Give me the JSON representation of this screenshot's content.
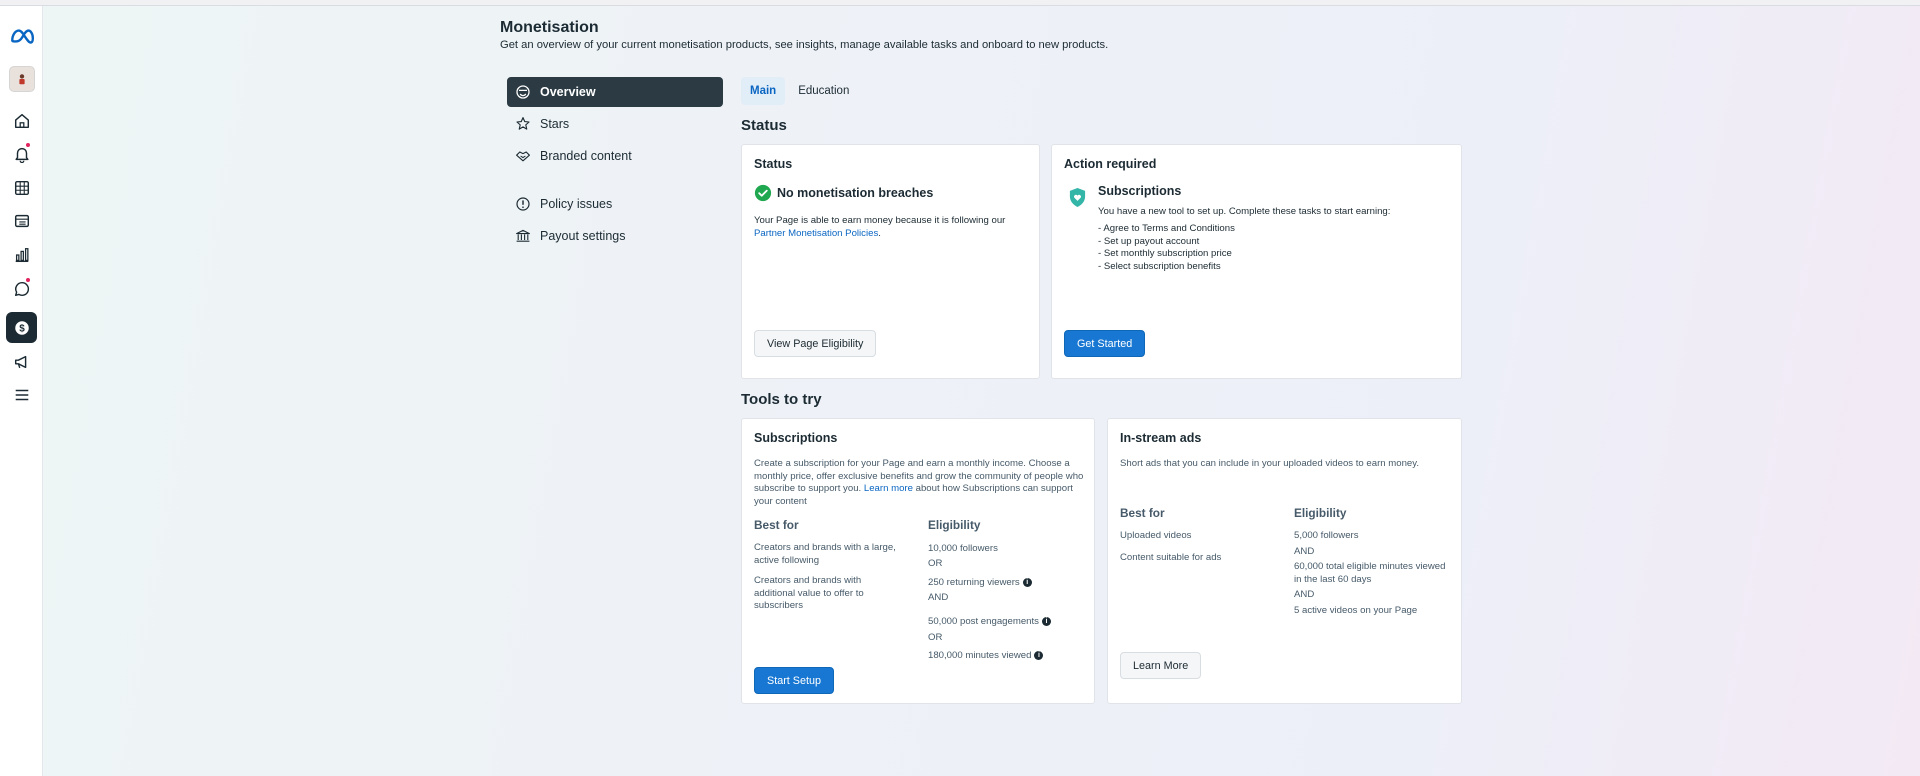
{
  "page": {
    "title": "Monetisation",
    "subtitle": "Get an overview of your current monetisation products, see insights, manage available tasks and onboard to new products."
  },
  "rail": {
    "items": [
      "meta-logo-icon",
      "avatar",
      "home-icon",
      "bell-icon",
      "table-icon",
      "pages-icon",
      "insights-icon",
      "chat-icon",
      "dollar-icon",
      "megaphone-icon",
      "menu-icon"
    ]
  },
  "sidebar": {
    "items": [
      {
        "label": "Overview",
        "icon": "smile-globe-icon",
        "active": true
      },
      {
        "label": "Stars",
        "icon": "star-icon"
      },
      {
        "label": "Branded content",
        "icon": "handshake-icon"
      },
      {
        "label": "Policy issues",
        "icon": "alert-icon"
      },
      {
        "label": "Payout settings",
        "icon": "bank-icon"
      }
    ]
  },
  "tabs": [
    {
      "label": "Main",
      "active": true
    },
    {
      "label": "Education"
    }
  ],
  "status_section": {
    "title": "Status",
    "status_card": {
      "title": "Status",
      "headline": "No monetisation breaches",
      "body_prefix": "Your Page is able to earn money because it is following our",
      "body_link": "Partner Monetisation Policies",
      "body_suffix": ".",
      "button": "View Page Eligibility"
    },
    "action_card": {
      "title": "Action required",
      "headline": "Subscriptions",
      "intro": "You have a new tool to set up. Complete these tasks to start earning:",
      "tasks": [
        "- Agree to Terms and Conditions",
        "- Set up payout account",
        "- Set monthly subscription price",
        "- Select subscription benefits"
      ],
      "button": "Get Started"
    }
  },
  "tools_section": {
    "title": "Tools to try",
    "subscriptions": {
      "title": "Subscriptions",
      "desc_prefix": "Create a subscription for your Page and earn a monthly income. Choose a monthly price, offer exclusive benefits and grow the community of people who subscribe to support you.",
      "desc_link": "Learn more",
      "desc_suffix": "about how Subscriptions can support your content",
      "best_for_label": "Best for",
      "best_for": [
        "Creators and brands with a large, active following",
        "Creators and brands with additional value to offer to subscribers"
      ],
      "eligibility_label": "Eligibility",
      "eligibility": [
        "10,000 followers",
        "OR",
        "250 returning viewers",
        "AND",
        "50,000 post engagements",
        "OR",
        "180,000 minutes viewed"
      ],
      "button": "Start Setup"
    },
    "instream": {
      "title": "In-stream ads",
      "desc": "Short ads that you can include in your uploaded videos to earn money.",
      "best_for_label": "Best for",
      "best_for": [
        "Uploaded videos",
        "Content suitable for ads"
      ],
      "eligibility_label": "Eligibility",
      "eligibility": [
        "5,000 followers",
        "AND",
        "60,000 total eligible minutes viewed in the last 60 days",
        "AND",
        "5 active videos on your Page"
      ],
      "button": "Learn More"
    }
  },
  "colors": {
    "accent": "#1877d2",
    "nav_active": "#2b3a43",
    "success": "#1fa84f",
    "notification": "#e0245e"
  }
}
